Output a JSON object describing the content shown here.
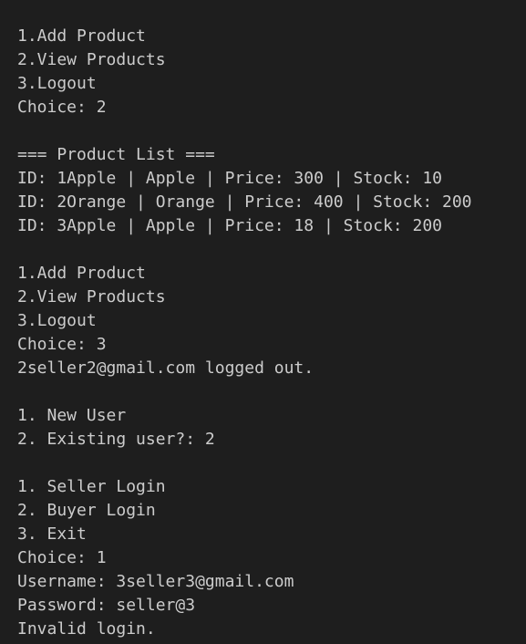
{
  "terminal": {
    "background": "#1e1e1e",
    "foreground": "#cccccc",
    "lines": [
      "1.Add Product",
      "2.View Products",
      "3.Logout",
      "Choice: 2",
      "",
      "=== Product List ===",
      "ID: 1Apple | Apple | Price: 300 | Stock: 10",
      "ID: 2Orange | Orange | Price: 400 | Stock: 200",
      "ID: 3Apple | Apple | Price: 18 | Stock: 200",
      "",
      "1.Add Product",
      "2.View Products",
      "3.Logout",
      "Choice: 3",
      "2seller2@gmail.com logged out.",
      "",
      "1. New User",
      "2. Existing user?: 2",
      "",
      "1. Seller Login",
      "2. Buyer Login",
      "3. Exit",
      "Choice: 1",
      "Username: 3seller3@gmail.com",
      "Password: seller@3",
      "Invalid login."
    ]
  }
}
